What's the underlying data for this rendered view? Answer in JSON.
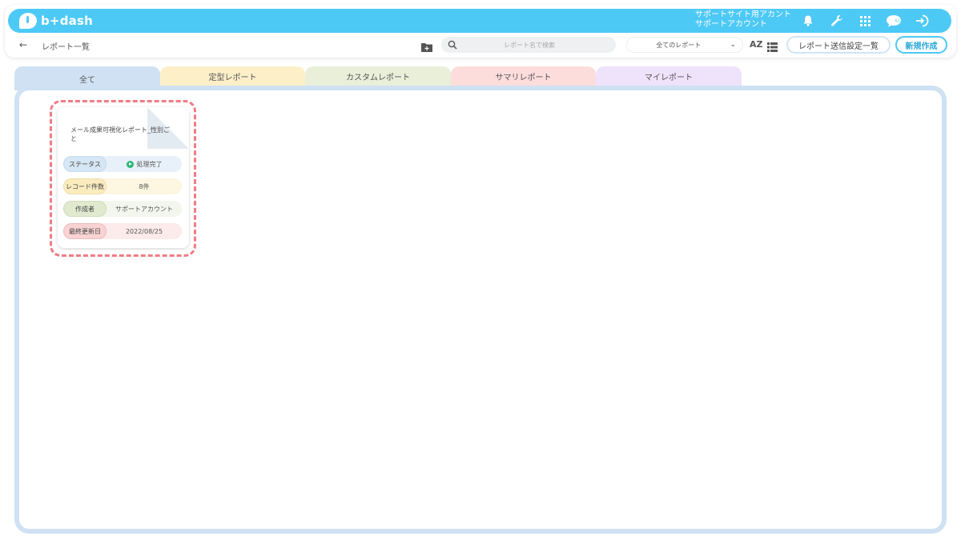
{
  "app": {
    "logo_text": "b+dash"
  },
  "header": {
    "account_line1": "サポートサイト用アカント",
    "account_line2": "サポートアカウント",
    "icons": [
      "bell-icon",
      "wrench-icon",
      "grid-icon",
      "chat-icon",
      "logout-icon"
    ]
  },
  "subbar": {
    "title": "レポート一覧",
    "search_placeholder": "レポート名で検索",
    "filter_value": "全てのレポート",
    "sort_label": "AZ",
    "send_settings_label": "レポート送信設定一覧",
    "new_label": "新規作成"
  },
  "tabs": [
    {
      "label": "全て",
      "color": "#cfe1f3",
      "active": true
    },
    {
      "label": "定型レポート",
      "color": "#fdf0c8"
    },
    {
      "label": "カスタムレポート",
      "color": "#e9efd9"
    },
    {
      "label": "サマリレポート",
      "color": "#fddcdc"
    },
    {
      "label": "マイレポート",
      "color": "#efe2fb"
    }
  ],
  "reports": [
    {
      "title": "メール成果可視化レポート_性別ごと",
      "status_label": "ステータス",
      "status_value": "処理完了",
      "records_label": "レコード件数",
      "records_value": "8件",
      "author_label": "作成者",
      "author_value": "サポートアカウント",
      "updated_label": "最終更新日",
      "updated_value": "2022/08/25"
    }
  ],
  "colors": {
    "brand": "#4dc9f6",
    "highlight": "#f07c84",
    "status_ok": "#2bb673"
  }
}
